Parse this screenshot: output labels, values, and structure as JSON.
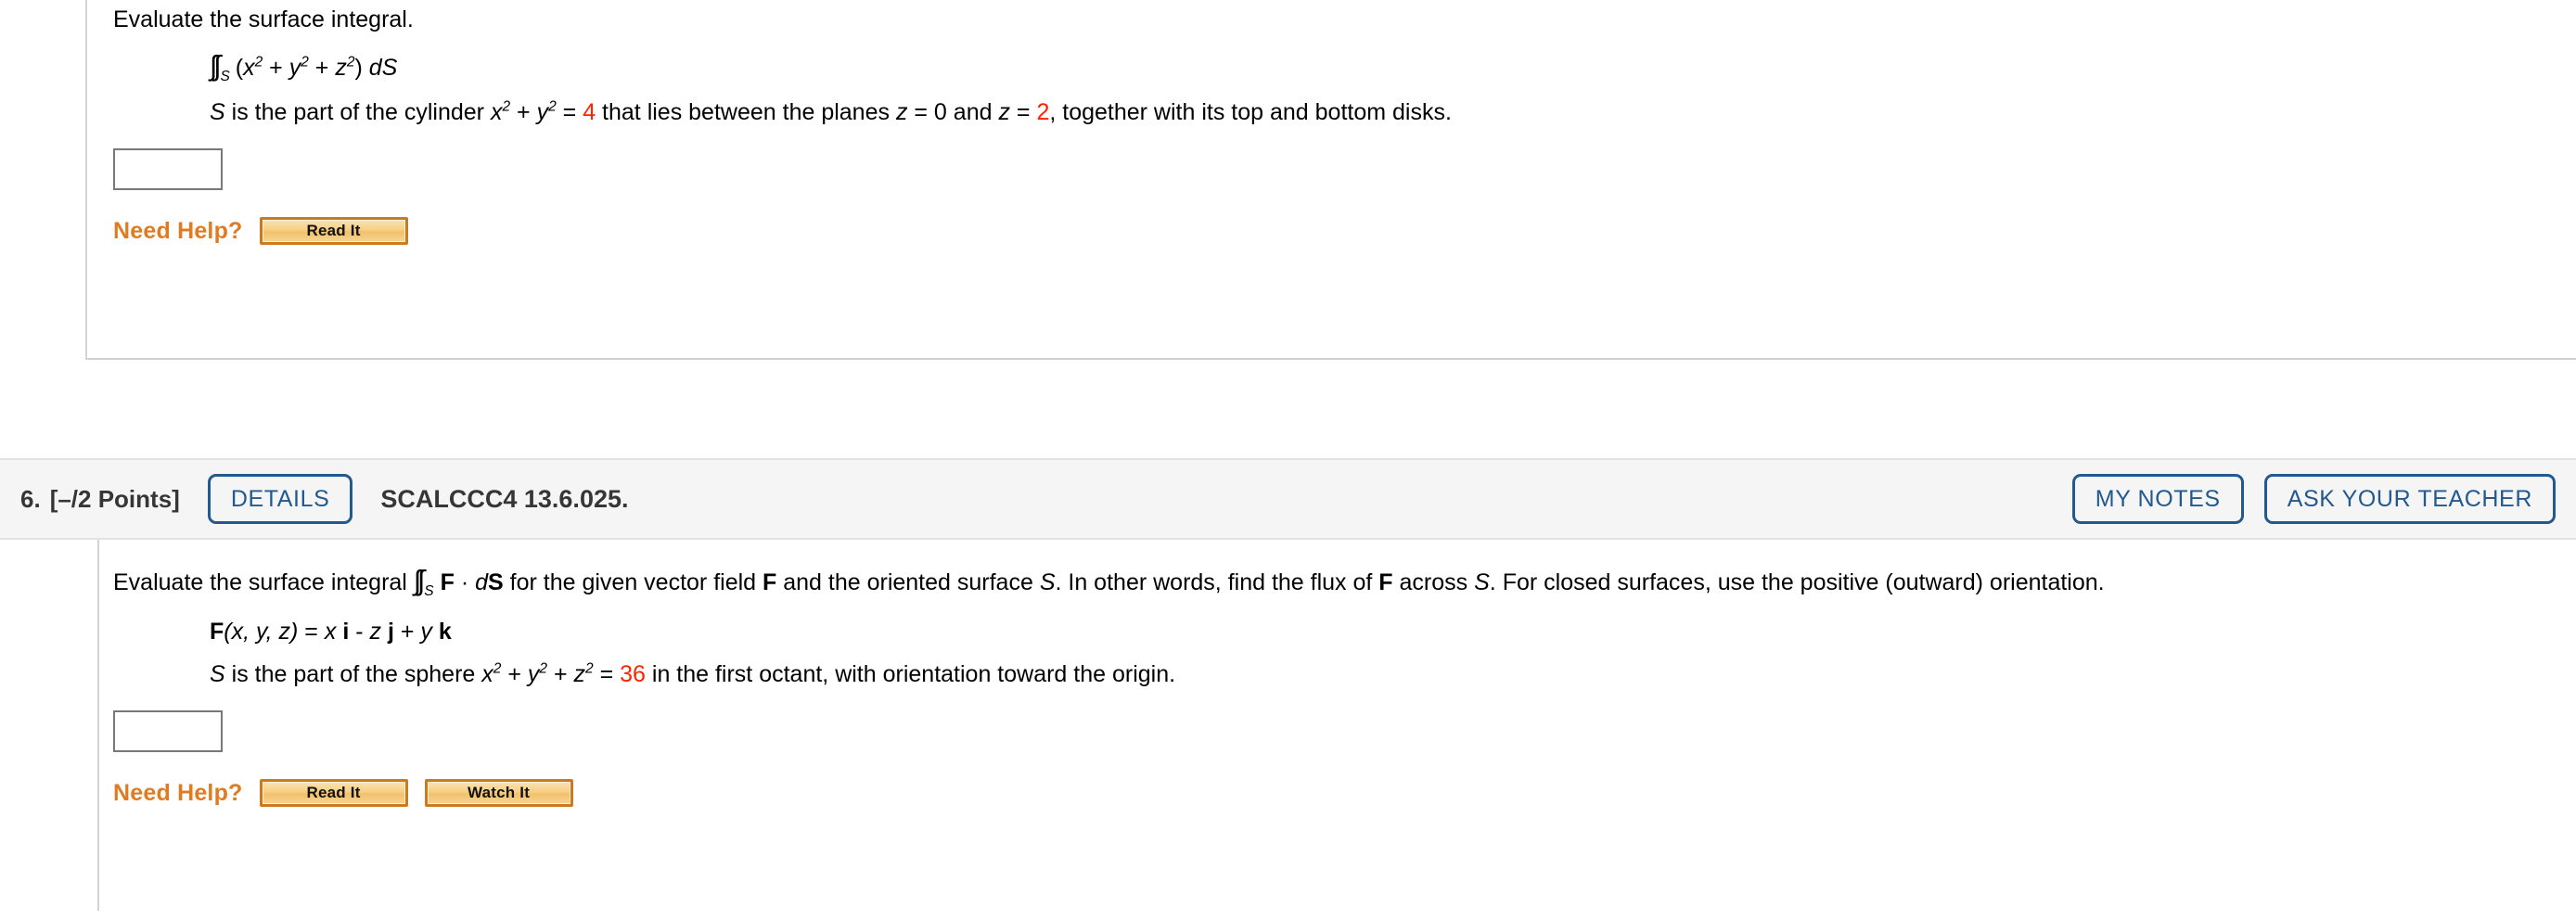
{
  "problem5": {
    "prompt": "Evaluate the surface integral.",
    "integral": {
      "symbol": "∫∫",
      "subscript": "S",
      "body_open": "(",
      "term1_base": "x",
      "term1_exp": "2",
      "plus1": " + ",
      "term2_base": "y",
      "term2_exp": "2",
      "plus2": " + ",
      "term3_base": "z",
      "term3_exp": "2",
      "body_close": ") ",
      "differential": "dS"
    },
    "condition": {
      "s_var": "S",
      "text_a": " is the part of the cylinder ",
      "x_base": "x",
      "x_exp": "2",
      "plus": " + ",
      "y_base": "y",
      "y_exp": "2",
      "equals": " = ",
      "value": "4",
      "text_b": " that lies between the planes ",
      "z1": "z",
      "z1_eq": " = 0",
      "text_c": " and ",
      "z2": "z",
      "z2_eq": " = ",
      "z2_value": "2",
      "text_d": ", together with its top and bottom disks."
    },
    "answer_value": "",
    "answer_placeholder": "",
    "need_help_label": "Need Help?",
    "buttons": [
      {
        "label": "Read It",
        "name": "read-it-button"
      }
    ]
  },
  "problem6": {
    "header": {
      "number": "6.",
      "points": "[–/2 Points]",
      "details_label": "DETAILS",
      "code": "SCALCCC4 13.6.025.",
      "my_notes_label": "MY NOTES",
      "ask_teacher_label": "ASK YOUR TEACHER"
    },
    "prompt": {
      "text_a": "Evaluate the surface integral ",
      "int_symbol": "∫∫",
      "int_sub": "S",
      "f_bold": "F",
      "dot": " · ",
      "d_italic": "d",
      "s_bold": "S",
      "text_b": " for the given vector field ",
      "f_bold2": "F",
      "text_c": " and the oriented surface ",
      "s_italic": "S",
      "text_d": ". In other words, find the flux of ",
      "f_bold3": "F",
      "text_e": " across ",
      "s_italic2": "S",
      "text_f": ". For closed surfaces, use the positive (outward) orientation."
    },
    "field": {
      "f": "F",
      "args": "(x, y, z)",
      "equals": " = ",
      "x": "x",
      "i": "i",
      "minus": " - ",
      "z": "z",
      "j": "j",
      "plus": " + ",
      "y": "y",
      "k": "k"
    },
    "condition": {
      "s_var": "S",
      "text_a": " is the part of the sphere ",
      "x_base": "x",
      "x_exp": "2",
      "plus1": " + ",
      "y_base": "y",
      "y_exp": "2",
      "plus2": " + ",
      "z_base": "z",
      "z_exp": "2",
      "equals": " = ",
      "value": "36",
      "text_b": " in the first octant, with orientation toward the origin."
    },
    "answer_value": "",
    "answer_placeholder": "",
    "need_help_label": "Need Help?",
    "buttons": [
      {
        "label": "Read It",
        "name": "read-it-button"
      },
      {
        "label": "Watch It",
        "name": "watch-it-button"
      }
    ]
  },
  "colors": {
    "accent_blue": "#22598f",
    "help_orange": "#e07b22",
    "value_red": "#ff2200",
    "header_bg": "#f5f5f5",
    "border_gray": "#d4d4d4"
  }
}
